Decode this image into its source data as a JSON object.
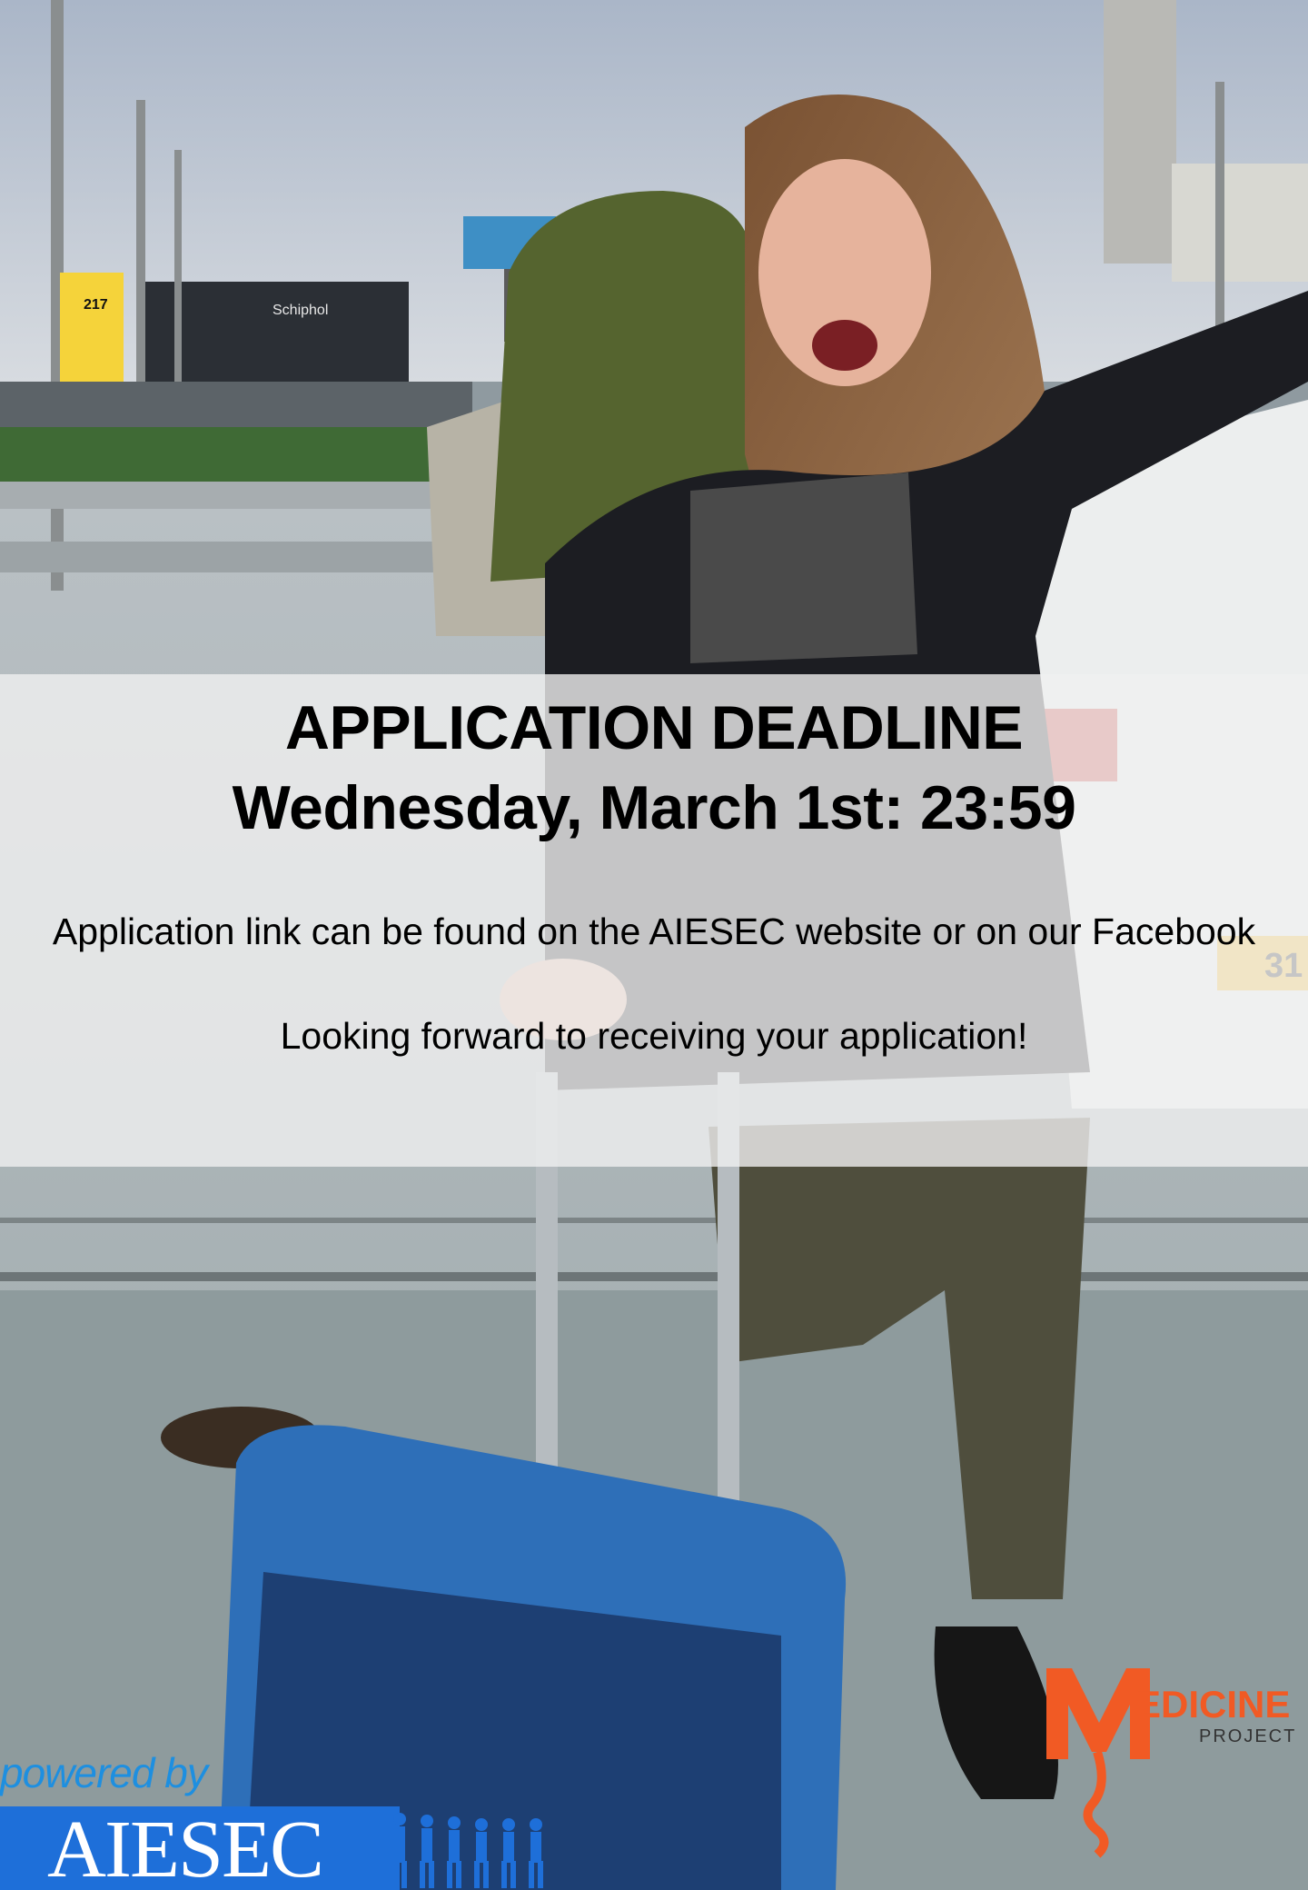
{
  "poster": {
    "headline_line1": "APPLICATION DEADLINE",
    "headline_line2": "Wednesday, March 1st: 23:59",
    "body_line1": "Application link can be found  on the AIESEC website or on our Facebook",
    "body_line2": "Looking forward to receiving your application!"
  },
  "branding": {
    "powered_by": "powered by",
    "aiesec_wordmark": "AIESEC",
    "medicine_project_title": "EDICINE",
    "medicine_project_sub": "PROJECT"
  },
  "photo": {
    "sign_text": "Schiphol",
    "parking_sign_text": "217",
    "plate_text": "31"
  },
  "colors": {
    "banner": "#f0f0f0",
    "aiesec_blue": "#1e6fd9",
    "medicine_orange": "#f15a24",
    "suitcase_blue": "#2e6fb8"
  }
}
